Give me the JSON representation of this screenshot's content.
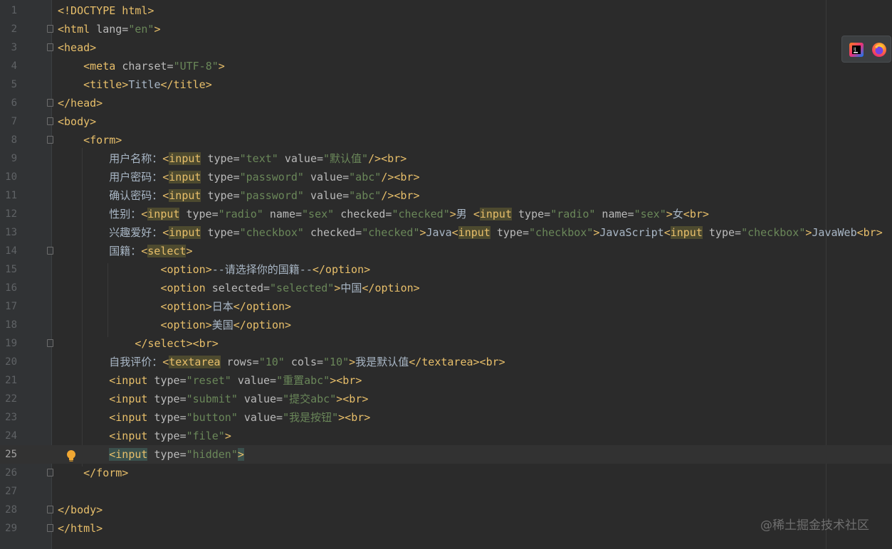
{
  "editor": {
    "current_line": 25,
    "lines": [
      {
        "n": "1",
        "tokens": [
          [
            "tag",
            "<!DOCTYPE html>"
          ]
        ]
      },
      {
        "n": "2",
        "fold": true,
        "tokens": [
          [
            "tag",
            "<html "
          ],
          [
            "attr",
            "lang="
          ],
          [
            "str",
            "\"en\""
          ],
          [
            "tag",
            ">"
          ]
        ]
      },
      {
        "n": "3",
        "fold": true,
        "tokens": [
          [
            "tag",
            "<head>"
          ]
        ]
      },
      {
        "n": "4",
        "tokens": [
          [
            "txt",
            "    "
          ],
          [
            "tag",
            "<meta "
          ],
          [
            "attr",
            "charset="
          ],
          [
            "str",
            "\"UTF-8\""
          ],
          [
            "tag",
            ">"
          ]
        ]
      },
      {
        "n": "5",
        "tokens": [
          [
            "txt",
            "    "
          ],
          [
            "tag",
            "<title>"
          ],
          [
            "txt",
            "Title"
          ],
          [
            "tag",
            "</title>"
          ]
        ]
      },
      {
        "n": "6",
        "fold": true,
        "tokens": [
          [
            "tag",
            "</head>"
          ]
        ]
      },
      {
        "n": "7",
        "fold": true,
        "tokens": [
          [
            "tag",
            "<body>"
          ]
        ]
      },
      {
        "n": "8",
        "fold": true,
        "tokens": [
          [
            "txt",
            "    "
          ],
          [
            "tag",
            "<form>"
          ]
        ]
      },
      {
        "n": "9",
        "tokens": [
          [
            "txt",
            "        用户名称："
          ],
          [
            "tag",
            "<"
          ],
          [
            "tag-hl",
            "input"
          ],
          [
            "attr",
            " type="
          ],
          [
            "str",
            "\"text\""
          ],
          [
            "attr",
            " value="
          ],
          [
            "str",
            "\"默认值\""
          ],
          [
            "tag",
            "/><br>"
          ]
        ]
      },
      {
        "n": "10",
        "tokens": [
          [
            "txt",
            "        用户密码："
          ],
          [
            "tag",
            "<"
          ],
          [
            "tag-hl",
            "input"
          ],
          [
            "attr",
            " type="
          ],
          [
            "str",
            "\"password\""
          ],
          [
            "attr",
            " value="
          ],
          [
            "str",
            "\"abc\""
          ],
          [
            "tag",
            "/><br>"
          ]
        ]
      },
      {
        "n": "11",
        "tokens": [
          [
            "txt",
            "        确认密码："
          ],
          [
            "tag",
            "<"
          ],
          [
            "tag-hl",
            "input"
          ],
          [
            "attr",
            " type="
          ],
          [
            "str",
            "\"password\""
          ],
          [
            "attr",
            " value="
          ],
          [
            "str",
            "\"abc\""
          ],
          [
            "tag",
            "/><br>"
          ]
        ]
      },
      {
        "n": "12",
        "tokens": [
          [
            "txt",
            "        性别："
          ],
          [
            "tag",
            "<"
          ],
          [
            "tag-hl",
            "input"
          ],
          [
            "attr",
            " type="
          ],
          [
            "str",
            "\"radio\""
          ],
          [
            "attr",
            " name="
          ],
          [
            "str",
            "\"sex\""
          ],
          [
            "attr",
            " checked="
          ],
          [
            "str",
            "\"checked\""
          ],
          [
            "tag",
            ">"
          ],
          [
            "txt",
            "男 "
          ],
          [
            "tag",
            "<"
          ],
          [
            "tag-hl",
            "input"
          ],
          [
            "attr",
            " type="
          ],
          [
            "str",
            "\"radio\""
          ],
          [
            "attr",
            " name="
          ],
          [
            "str",
            "\"sex\""
          ],
          [
            "tag",
            ">"
          ],
          [
            "txt",
            "女"
          ],
          [
            "tag",
            "<br>"
          ]
        ]
      },
      {
        "n": "13",
        "tokens": [
          [
            "txt",
            "        兴趣爱好："
          ],
          [
            "tag",
            "<"
          ],
          [
            "tag-hl",
            "input"
          ],
          [
            "attr",
            " type="
          ],
          [
            "str",
            "\"checkbox\""
          ],
          [
            "attr",
            " checked="
          ],
          [
            "str",
            "\"checked\""
          ],
          [
            "tag",
            ">"
          ],
          [
            "txt",
            "Java"
          ],
          [
            "tag",
            "<"
          ],
          [
            "tag-hl",
            "input"
          ],
          [
            "attr",
            " type="
          ],
          [
            "str",
            "\"checkbox\""
          ],
          [
            "tag",
            ">"
          ],
          [
            "txt",
            "JavaScript"
          ],
          [
            "tag",
            "<"
          ],
          [
            "tag-hl",
            "input"
          ],
          [
            "attr",
            " type="
          ],
          [
            "str",
            "\"checkbox\""
          ],
          [
            "tag",
            ">"
          ],
          [
            "txt",
            "JavaWeb"
          ],
          [
            "tag",
            "<br>"
          ]
        ]
      },
      {
        "n": "14",
        "fold": true,
        "tokens": [
          [
            "txt",
            "        国籍："
          ],
          [
            "tag",
            "<"
          ],
          [
            "tag-hl",
            "select"
          ],
          [
            "tag",
            ">"
          ]
        ]
      },
      {
        "n": "15",
        "tokens": [
          [
            "txt",
            "                "
          ],
          [
            "tag",
            "<option>"
          ],
          [
            "txt",
            "--请选择你的国籍--"
          ],
          [
            "tag",
            "</option>"
          ]
        ]
      },
      {
        "n": "16",
        "tokens": [
          [
            "txt",
            "                "
          ],
          [
            "tag",
            "<option "
          ],
          [
            "attr",
            "selected="
          ],
          [
            "str",
            "\"selected\""
          ],
          [
            "tag",
            ">"
          ],
          [
            "txt",
            "中国"
          ],
          [
            "tag",
            "</option>"
          ]
        ]
      },
      {
        "n": "17",
        "tokens": [
          [
            "txt",
            "                "
          ],
          [
            "tag",
            "<option>"
          ],
          [
            "txt",
            "日本"
          ],
          [
            "tag",
            "</option>"
          ]
        ]
      },
      {
        "n": "18",
        "tokens": [
          [
            "txt",
            "                "
          ],
          [
            "tag",
            "<option>"
          ],
          [
            "txt",
            "美国"
          ],
          [
            "tag",
            "</option>"
          ]
        ]
      },
      {
        "n": "19",
        "fold": true,
        "tokens": [
          [
            "txt",
            "            "
          ],
          [
            "tag",
            "</select><br>"
          ]
        ]
      },
      {
        "n": "20",
        "tokens": [
          [
            "txt",
            "        自我评价："
          ],
          [
            "tag",
            "<"
          ],
          [
            "tag-hl",
            "textarea"
          ],
          [
            "attr",
            " rows="
          ],
          [
            "str",
            "\"10\""
          ],
          [
            "attr",
            " cols="
          ],
          [
            "str",
            "\"10\""
          ],
          [
            "tag",
            ">"
          ],
          [
            "txt",
            "我是默认值"
          ],
          [
            "tag",
            "</textarea><br>"
          ]
        ]
      },
      {
        "n": "21",
        "tokens": [
          [
            "txt",
            "        "
          ],
          [
            "tag",
            "<input "
          ],
          [
            "attr",
            "type="
          ],
          [
            "str",
            "\"reset\""
          ],
          [
            "attr",
            " value="
          ],
          [
            "str",
            "\"重置abc\""
          ],
          [
            "tag",
            "><br>"
          ]
        ]
      },
      {
        "n": "22",
        "tokens": [
          [
            "txt",
            "        "
          ],
          [
            "tag",
            "<input "
          ],
          [
            "attr",
            "type="
          ],
          [
            "str",
            "\"submit\""
          ],
          [
            "attr",
            " value="
          ],
          [
            "str",
            "\"提交abc\""
          ],
          [
            "tag",
            "><br>"
          ]
        ]
      },
      {
        "n": "23",
        "tokens": [
          [
            "txt",
            "        "
          ],
          [
            "tag",
            "<input "
          ],
          [
            "attr",
            "type="
          ],
          [
            "str",
            "\"button\""
          ],
          [
            "attr",
            " value="
          ],
          [
            "str",
            "\"我是按钮\""
          ],
          [
            "tag",
            "><br>"
          ]
        ]
      },
      {
        "n": "24",
        "tokens": [
          [
            "txt",
            "        "
          ],
          [
            "tag",
            "<input "
          ],
          [
            "attr",
            "type="
          ],
          [
            "str",
            "\"file\""
          ],
          [
            "tag",
            ">"
          ]
        ]
      },
      {
        "n": "25",
        "bulb": true,
        "tokens": [
          [
            "txt",
            "        "
          ],
          [
            "tag-hl2",
            "<input"
          ],
          [
            "attr",
            " type="
          ],
          [
            "str",
            "\"hidden\""
          ],
          [
            "tag-hl2",
            ">"
          ]
        ]
      },
      {
        "n": "26",
        "fold": true,
        "tokens": [
          [
            "txt",
            "    "
          ],
          [
            "tag",
            "</form>"
          ]
        ]
      },
      {
        "n": "27",
        "tokens": []
      },
      {
        "n": "28",
        "fold": true,
        "tokens": [
          [
            "tag",
            "</body>"
          ]
        ]
      },
      {
        "n": "29",
        "fold": true,
        "tokens": [
          [
            "tag",
            "</html>"
          ]
        ]
      }
    ]
  },
  "toolbar": {
    "buttons": [
      {
        "name": "intellij-browser-icon",
        "color": "#e9317a"
      },
      {
        "name": "firefox-browser-icon",
        "color": "#ff7139"
      }
    ]
  },
  "watermark": "@稀土掘金技术社区"
}
